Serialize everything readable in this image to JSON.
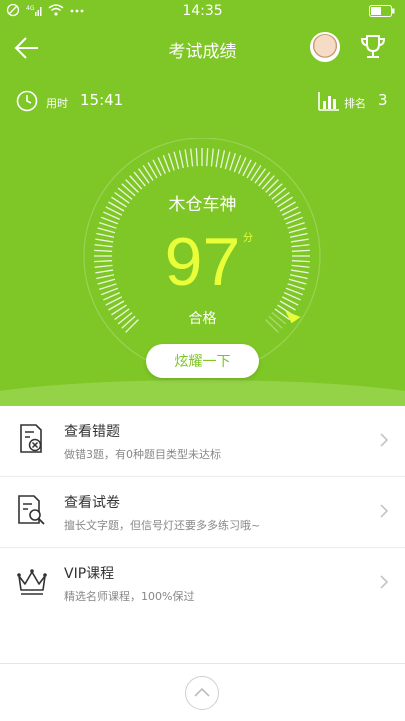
{
  "status_bar": {
    "time": "14:35",
    "network_icons": [
      "hd-icon",
      "signal-icon",
      "wifi-icon",
      "more-icon"
    ],
    "battery_icon": "battery-icon"
  },
  "header": {
    "title": "考试成绩",
    "back_icon": "arrow-left-icon",
    "trophy_icon": "trophy-icon"
  },
  "stats": {
    "time_label": "用时",
    "time_value": "15:41",
    "rank_label": "排名",
    "rank_value": "3"
  },
  "result": {
    "user_name": "木仓车神",
    "score": "97",
    "score_unit": "分",
    "pass_label": "合格",
    "gauge_fraction": 0.97
  },
  "share_button": "炫耀一下",
  "menu": [
    {
      "icon": "error-doc-icon",
      "title": "查看错题",
      "subtitle": "做错3题，有0种题目类型未达标"
    },
    {
      "icon": "search-doc-icon",
      "title": "查看试卷",
      "subtitle": "擅长文字题，但信号灯还要多多练习哦~"
    },
    {
      "icon": "crown-icon",
      "title": "VIP课程",
      "subtitle": "精选名师课程，100%保过"
    }
  ],
  "colors": {
    "primary_green": "#7ec726",
    "score_yellow": "#e8ff3a"
  }
}
